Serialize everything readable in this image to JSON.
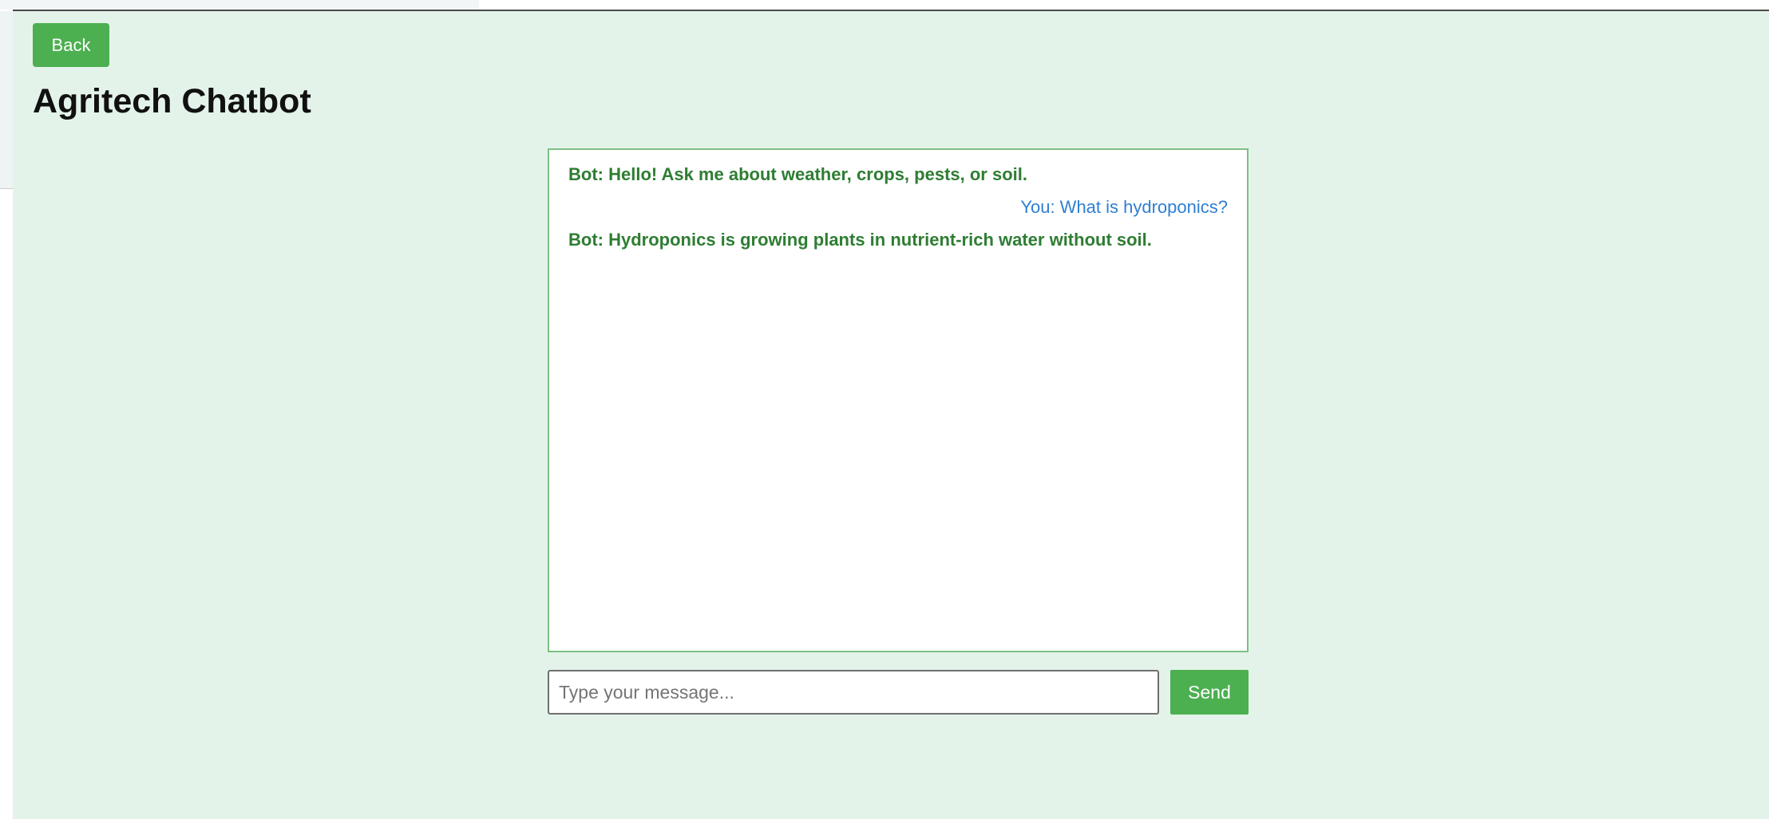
{
  "header": {
    "back_label": "Back",
    "title": "Agritech Chatbot"
  },
  "chat": {
    "messages": [
      {
        "sender": "bot",
        "text": "Bot: Hello! Ask me about weather, crops, pests, or soil."
      },
      {
        "sender": "user",
        "text": "You: What is hydroponics?"
      },
      {
        "sender": "bot",
        "text": "Bot: Hydroponics is growing plants in nutrient-rich water without soil."
      }
    ]
  },
  "composer": {
    "placeholder": "Type your message...",
    "value": "",
    "send_label": "Send"
  },
  "colors": {
    "background": "#e4f3e9",
    "accent": "#4caf50",
    "bot_text": "#2e7d32",
    "user_text": "#2f7fd1",
    "chat_border": "#7dc083"
  }
}
